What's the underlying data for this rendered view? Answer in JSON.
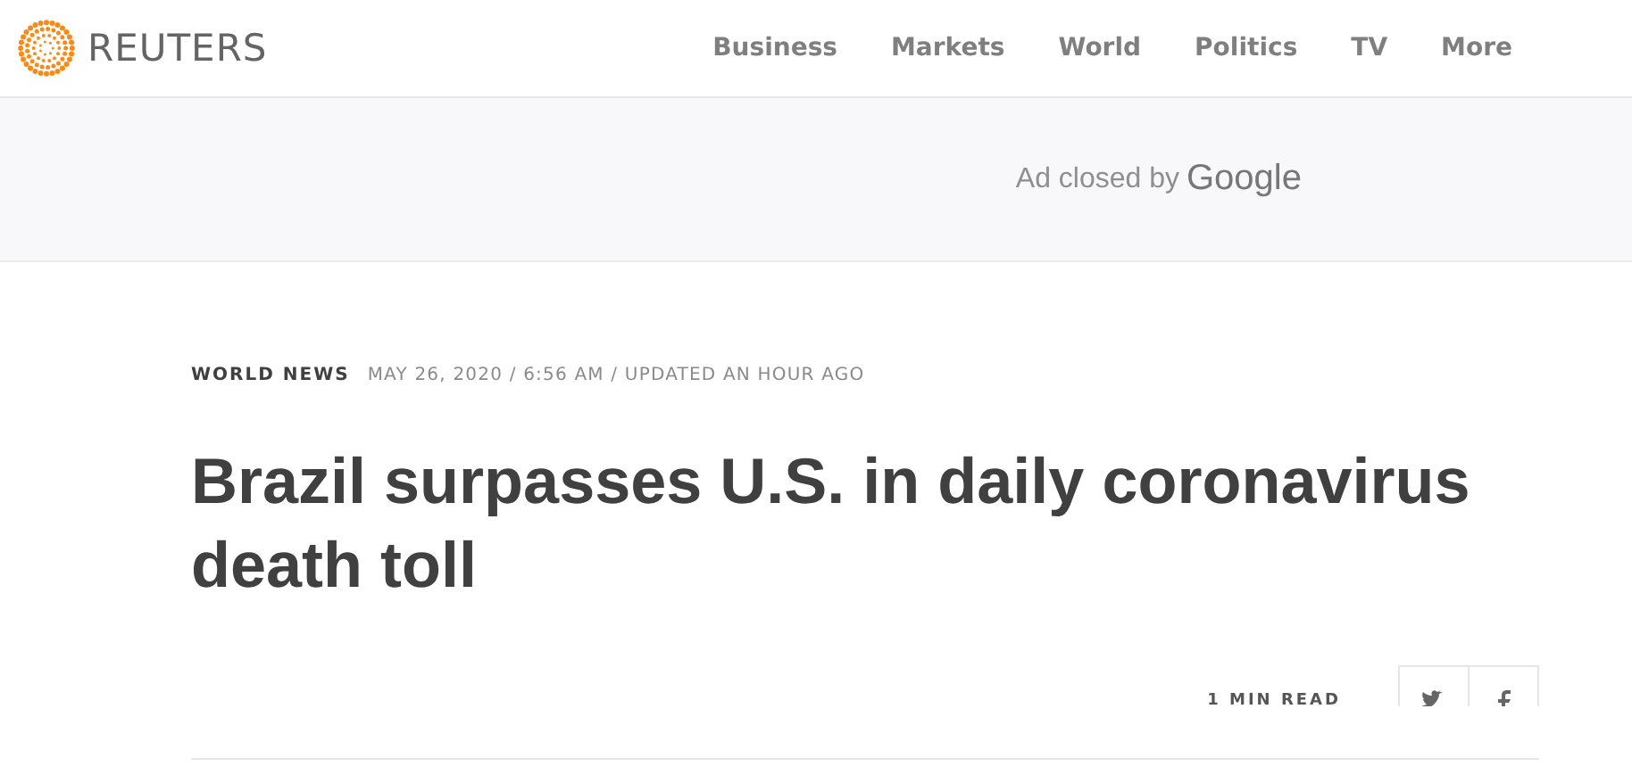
{
  "header": {
    "brand": "REUTERS",
    "nav": [
      "Business",
      "Markets",
      "World",
      "Politics",
      "TV",
      "More"
    ]
  },
  "ad": {
    "text": "Ad closed by",
    "provider": "Google"
  },
  "article": {
    "section": "WORLD NEWS",
    "dateline": "MAY 26, 2020 / 6:56 AM / UPDATED AN HOUR AGO",
    "headline": "Brazil surpasses U.S. in daily coronavirus death toll",
    "read_time": "1 MIN READ",
    "share": [
      {
        "kind": "twitter"
      },
      {
        "kind": "facebook"
      }
    ]
  }
}
